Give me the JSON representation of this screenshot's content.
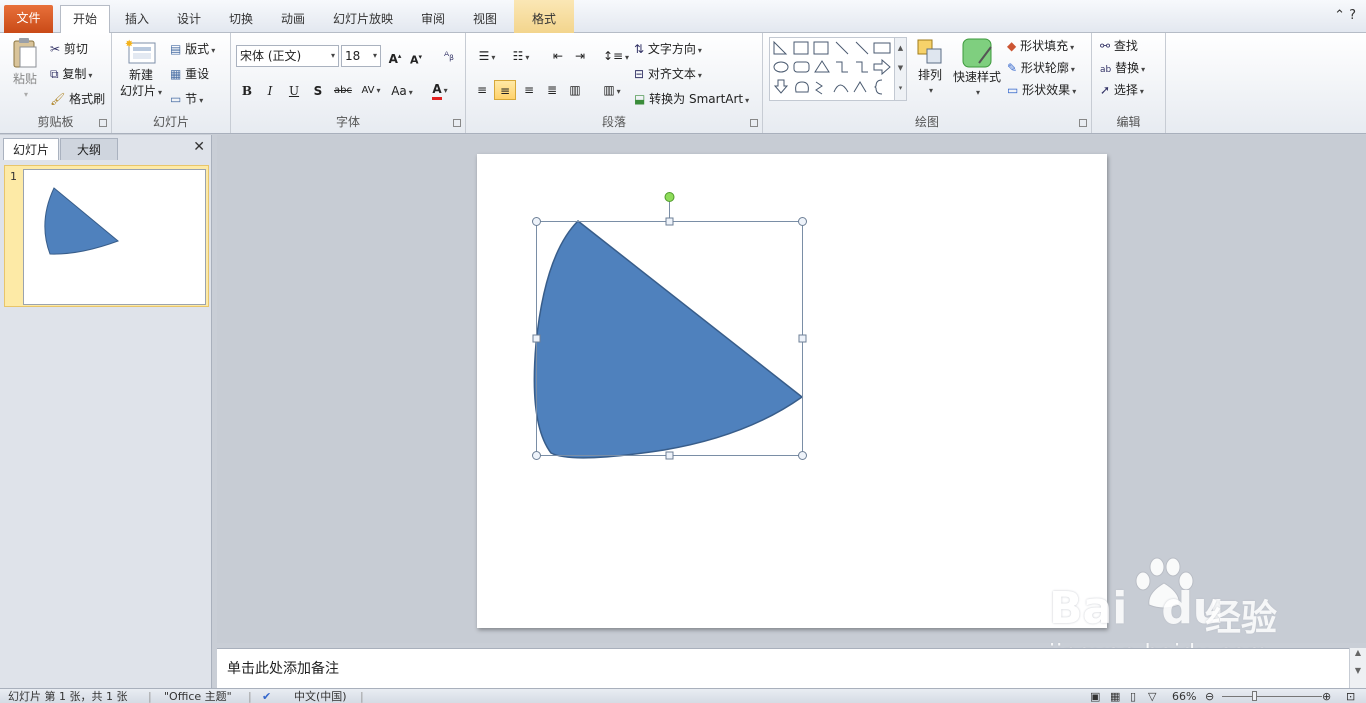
{
  "tabs": {
    "file": "文件",
    "home": "开始",
    "insert": "插入",
    "design": "设计",
    "transitions": "切换",
    "animations": "动画",
    "slideshow": "幻灯片放映",
    "review": "审阅",
    "view": "视图",
    "format": "格式"
  },
  "clipboard": {
    "paste": "粘贴",
    "cut": "剪切",
    "copy": "复制",
    "format_painter": "格式刷",
    "label": "剪贴板"
  },
  "slides_group": {
    "new_slide_top": "新建",
    "new_slide_bottom": "幻灯片",
    "layout": "版式",
    "reset": "重设",
    "section": "节",
    "label": "幻灯片"
  },
  "font": {
    "family": "宋体 (正文)",
    "size": "18",
    "label": "字体"
  },
  "paragraph": {
    "text_direction": "文字方向",
    "align_text": "对齐文本",
    "convert_smartart": "转换为 SmartArt",
    "label": "段落"
  },
  "drawing": {
    "arrange": "排列",
    "quick_styles": "快速样式",
    "shape_fill": "形状填充",
    "shape_outline": "形状轮廓",
    "shape_effects": "形状效果",
    "label": "绘图"
  },
  "editing": {
    "find": "查找",
    "replace": "替换",
    "select": "选择",
    "label": "编辑"
  },
  "left_pane": {
    "tab_slides": "幻灯片",
    "tab_outline": "大纲",
    "slide_number": "1"
  },
  "notes": {
    "placeholder": "单击此处添加备注"
  },
  "status": {
    "slide_info": "幻灯片 第 1 张，共 1 张",
    "theme": "\"Office 主题\"",
    "language": "中文(中国)",
    "zoom": "66%"
  },
  "watermark": {
    "brand": "Bai",
    "brand2": "du",
    "suffix": "经验",
    "url": "jingyan.baidu.com"
  },
  "colors": {
    "shape_fill": "#4f81bd",
    "shape_stroke": "#385d8a",
    "file_tab": "#d45a22",
    "selection": "#ffd26b"
  }
}
